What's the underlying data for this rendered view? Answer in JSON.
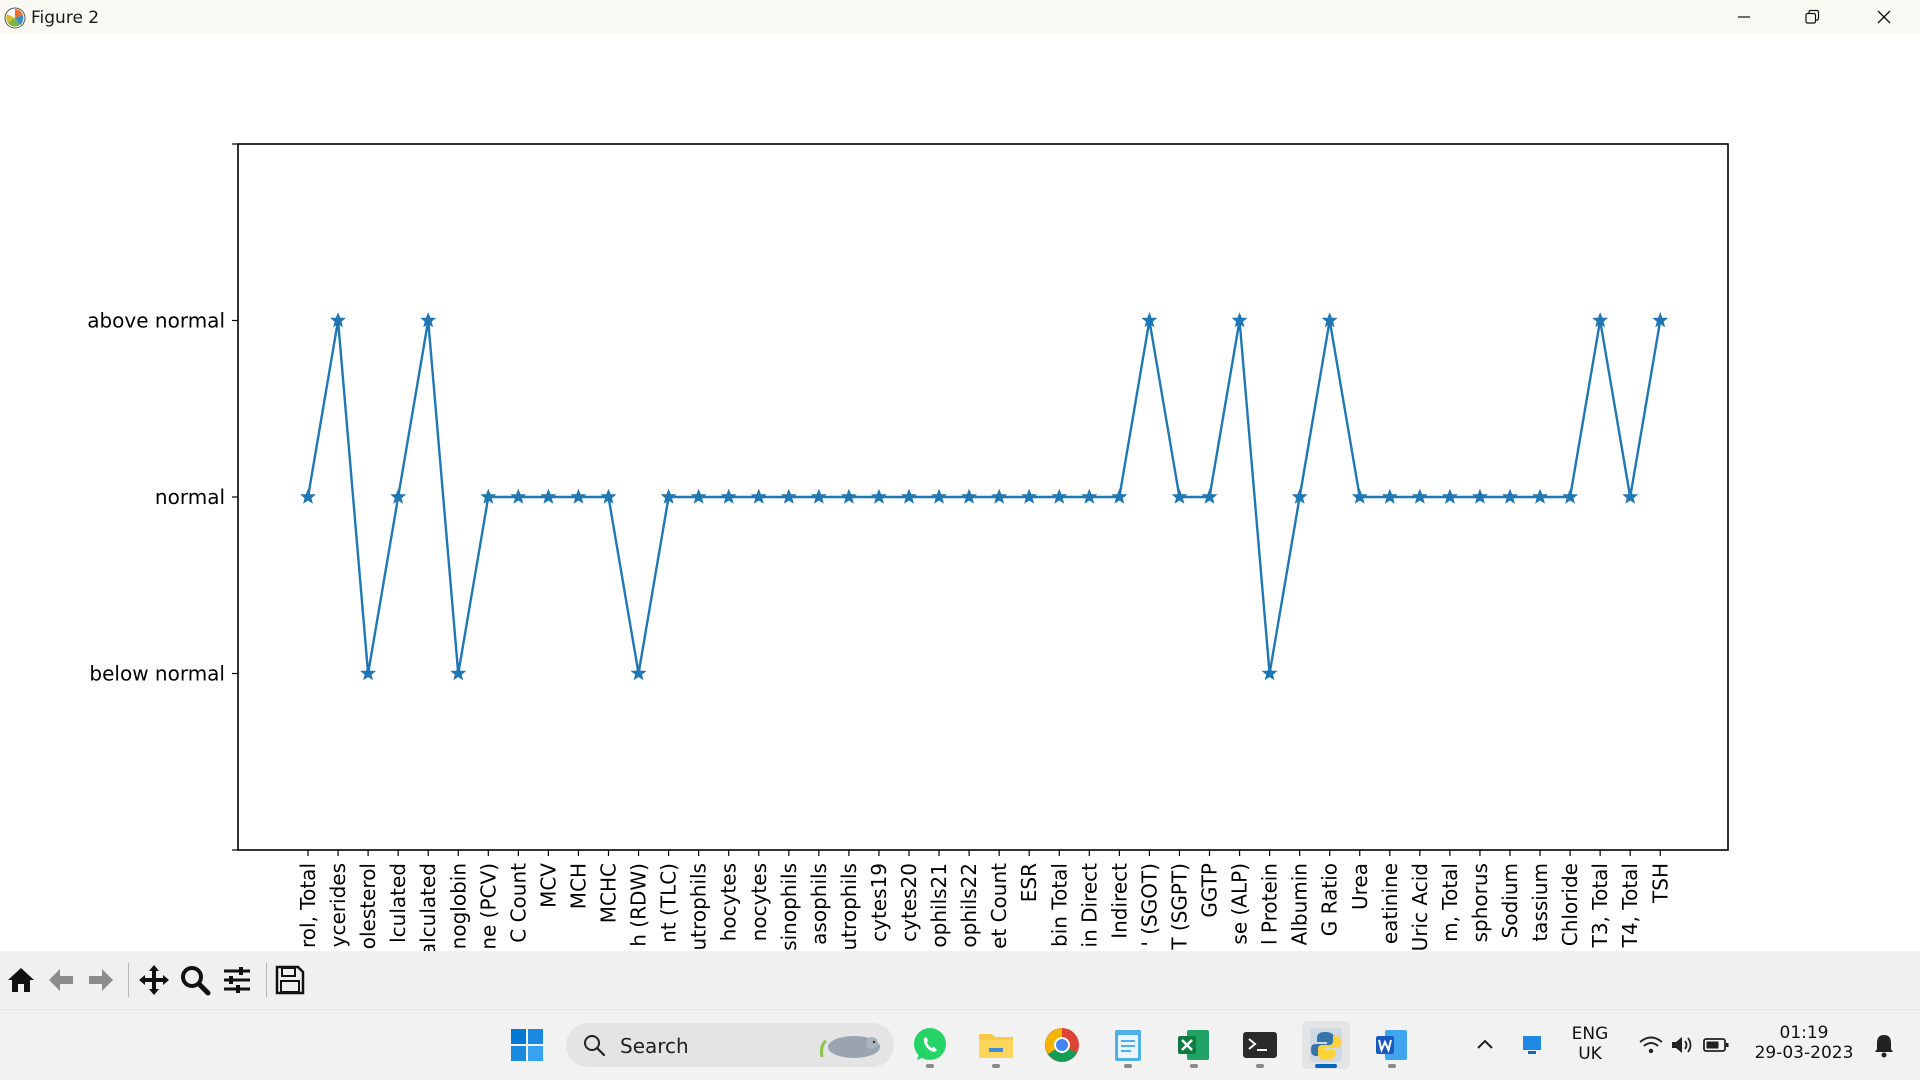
{
  "window": {
    "title": "Figure 2",
    "controls": [
      "minimize",
      "restore",
      "close"
    ]
  },
  "chart_data": {
    "type": "line",
    "title": "",
    "xlabel": "",
    "ylabel": "",
    "marker": "star",
    "line_color": "#1f77b4",
    "y_ticks": [
      {
        "value": 0,
        "label": "below normal"
      },
      {
        "value": 1,
        "label": "normal"
      },
      {
        "value": 2,
        "label": "above normal"
      }
    ],
    "ylim": [
      -1,
      3
    ],
    "categories": [
      "rol, Total",
      "ycerides",
      "olesterol",
      "lculated",
      "alculated",
      "noglobin",
      "ne (PCV)",
      "C Count",
      "MCV",
      "MCH",
      "MCHC",
      "h (RDW)",
      "nt (TLC)",
      "utrophils",
      "hocytes",
      "nocytes",
      "sinophils",
      "asophils",
      "utrophils",
      "cytes19",
      "cytes20",
      "ophils21",
      "ophils22",
      "et Count",
      "ESR",
      "bin Total",
      "in Direct",
      "Indirect",
      "' (SGOT)",
      "T (SGPT)",
      "GGTP",
      "se (ALP)",
      "l Protein",
      "Albumin",
      "G Ratio",
      "Urea",
      "eatinine",
      "Uric Acid",
      "m, Total",
      "sphorus",
      "Sodium",
      "tassium",
      "Chloride",
      "T3, Total",
      "T4, Total",
      "TSH"
    ],
    "values": [
      1,
      2,
      0,
      1,
      2,
      0,
      1,
      1,
      1,
      1,
      1,
      0,
      1,
      1,
      1,
      1,
      1,
      1,
      1,
      1,
      1,
      1,
      1,
      1,
      1,
      1,
      1,
      1,
      2,
      1,
      1,
      2,
      0,
      1,
      2,
      1,
      1,
      1,
      1,
      1,
      1,
      1,
      1,
      2,
      1,
      2
    ]
  },
  "toolbar": {
    "buttons": [
      "home-icon",
      "back-arrow-icon",
      "forward-arrow-icon",
      "pan-move-icon",
      "zoom-magnifier-icon",
      "configure-subplots-icon",
      "save-disk-icon"
    ]
  },
  "taskbar": {
    "search_label": "Search",
    "apps": [
      "windows-start",
      "whatsapp",
      "file-explorer",
      "chrome",
      "notepad",
      "excel",
      "terminal",
      "python",
      "word"
    ],
    "active_app": "python",
    "lang_primary": "ENG",
    "lang_secondary": "UK",
    "time": "01:19",
    "date": "29-03-2023"
  }
}
